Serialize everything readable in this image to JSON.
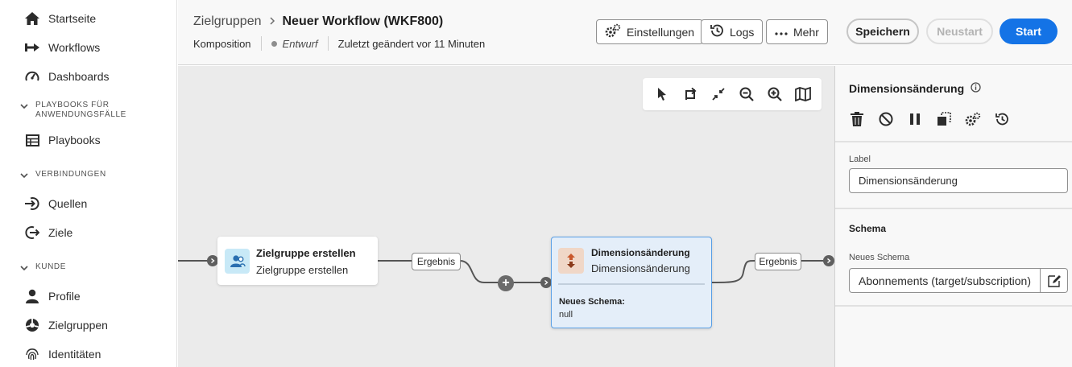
{
  "sidebar": {
    "items": [
      {
        "label": "Startseite",
        "icon": "home-icon"
      },
      {
        "label": "Workflows",
        "icon": "workflow-icon"
      },
      {
        "label": "Dashboards",
        "icon": "gauge-icon"
      }
    ],
    "sections": [
      {
        "label": "PLAYBOOKS FÜR ANWENDUNGSFÄLLE",
        "line1": "PLAYBOOKS FÜR",
        "line2": "ANWENDUNGSFÄLLE",
        "items": [
          {
            "label": "Playbooks",
            "icon": "playbook-icon"
          }
        ]
      },
      {
        "label": "VERBINDUNGEN",
        "items": [
          {
            "label": "Quellen",
            "icon": "source-icon"
          },
          {
            "label": "Ziele",
            "icon": "destination-icon"
          }
        ]
      },
      {
        "label": "KUNDE",
        "items": [
          {
            "label": "Profile",
            "icon": "profile-icon"
          },
          {
            "label": "Zielgruppen",
            "icon": "audience-icon"
          },
          {
            "label": "Identitäten",
            "icon": "fingerprint-icon"
          }
        ]
      }
    ]
  },
  "header": {
    "breadcrumb_parent": "Zielgruppen",
    "title": "Neuer Workflow",
    "title_id": "(WKF800)",
    "composition": "Komposition",
    "status": "Entwurf",
    "modified": "Zuletzt geändert vor 11 Minuten",
    "buttons": {
      "settings": "Einstellungen",
      "logs": "Logs",
      "more": "Mehr",
      "save": "Speichern",
      "restart": "Neustart",
      "start": "Start"
    }
  },
  "canvas": {
    "node1": {
      "title": "Zielgruppe erstellen",
      "subtitle": "Zielgruppe erstellen",
      "icon": "audience-icon"
    },
    "node2": {
      "title": "Dimensionsänderung",
      "subtitle": "Dimensionsänderung",
      "schema_label": "Neues Schema:",
      "schema_value": "null",
      "icon": "dimension-change-icon"
    },
    "transition1": "Ergebnis",
    "transition2": "Ergebnis",
    "toolbar": [
      "pointer-icon",
      "swap-icon",
      "collapse-icon",
      "zoom-out-icon",
      "zoom-in-icon",
      "map-icon"
    ]
  },
  "panel": {
    "title": "Dimensionsänderung",
    "label_caption": "Label",
    "label_value": "Dimensionsänderung",
    "schema_heading": "Schema",
    "new_schema_caption": "Neues Schema",
    "new_schema_value": "Abonnements (target/subscription)",
    "actions": [
      "delete-icon",
      "disable-icon",
      "pause-icon",
      "copy-icon",
      "settings-icon",
      "history-icon"
    ]
  },
  "colors": {
    "accent": "#1473e6",
    "node_selected_bg": "#e4eef9",
    "node_selected_border": "#5aa0e6",
    "canvas_bg": "#ebebeb"
  }
}
